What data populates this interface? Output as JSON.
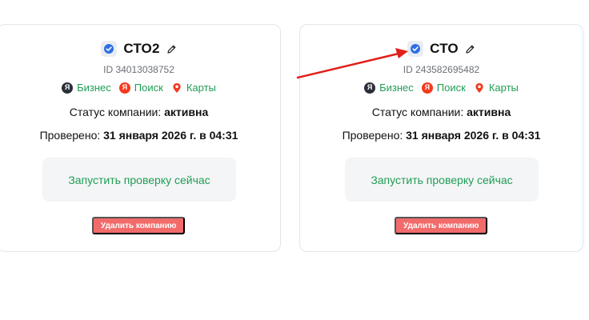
{
  "cards": [
    {
      "name": "СТО2",
      "id_text": "ID 34013038752",
      "services": {
        "business": "Бизнес",
        "search": "Поиск",
        "maps": "Карты"
      },
      "status_label": "Статус компании:",
      "status_value": "активна",
      "checked_label": "Проверено:",
      "checked_value": "31 января 2026 г. в 04:31",
      "run_button": "Запустить проверку сейчас",
      "delete_button": "Удалить компанию"
    },
    {
      "name": "СТО",
      "id_text": "ID 243582695482",
      "services": {
        "business": "Бизнес",
        "search": "Поиск",
        "maps": "Карты"
      },
      "status_label": "Статус компании:",
      "status_value": "активна",
      "checked_label": "Проверено:",
      "checked_value": "31 января 2026 г. в 04:31",
      "run_button": "Запустить проверку сейчас",
      "delete_button": "Удалить компанию"
    }
  ],
  "icons": {
    "verified": "verified-badge-icon",
    "edit": "pencil-icon",
    "business": "yandex-business-icon",
    "search": "yandex-search-icon",
    "maps": "yandex-maps-pin-icon"
  },
  "colors": {
    "accent_green": "#1f9d55",
    "delete_red": "#f26b6b",
    "verified_blue": "#2f6fe4",
    "annotation_arrow": "#e0201b"
  }
}
